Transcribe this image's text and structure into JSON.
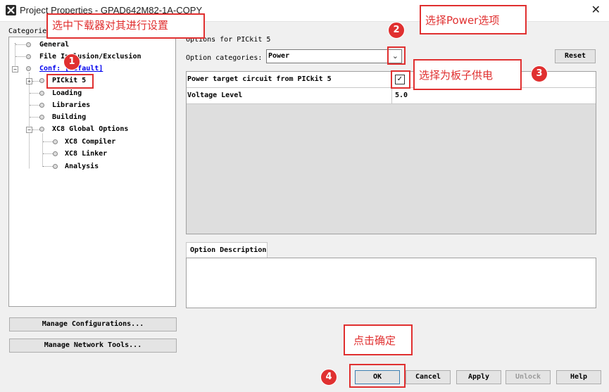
{
  "window": {
    "title": "Project Properties - GPAD642M82-1A-COPY"
  },
  "categories": {
    "label": "Categories:",
    "items": {
      "general": "General",
      "file_inclusion": "File Inclusion/Exclusion",
      "conf": "Conf: [default]",
      "pickit": "PICkit 5",
      "loading": "Loading",
      "libraries": "Libraries",
      "building": "Building",
      "xc8_global": "XC8 Global Options",
      "xc8_compiler": "XC8 Compiler",
      "xc8_linker": "XC8 Linker",
      "analysis": "Analysis"
    }
  },
  "left_buttons": {
    "manage_configurations": "Manage Configurations...",
    "manage_network_tools": "Manage Network Tools..."
  },
  "options": {
    "title": "Options for PICkit 5",
    "category_label": "Option categories:",
    "category_value": "Power",
    "reset_label": "Reset",
    "rows": [
      {
        "name": "Power target circuit from PICkit 5",
        "type": "checkbox",
        "checked": true
      },
      {
        "name": "Voltage Level",
        "value": "5.0"
      }
    ],
    "description_tab": "Option Description"
  },
  "dialog_buttons": {
    "ok": "OK",
    "cancel": "Cancel",
    "apply": "Apply",
    "unlock": "Unlock",
    "help": "Help"
  },
  "annotations": {
    "step1": {
      "number": "1",
      "text": "选中下载器对其进行设置"
    },
    "step2": {
      "number": "2",
      "text": "选择Power选项"
    },
    "step3": {
      "number": "3",
      "text": "选择为板子供电"
    },
    "step4": {
      "number": "4",
      "text": "点击确定"
    }
  },
  "colors": {
    "annotation_red": "#e03030",
    "link_blue": "#0000ee"
  }
}
